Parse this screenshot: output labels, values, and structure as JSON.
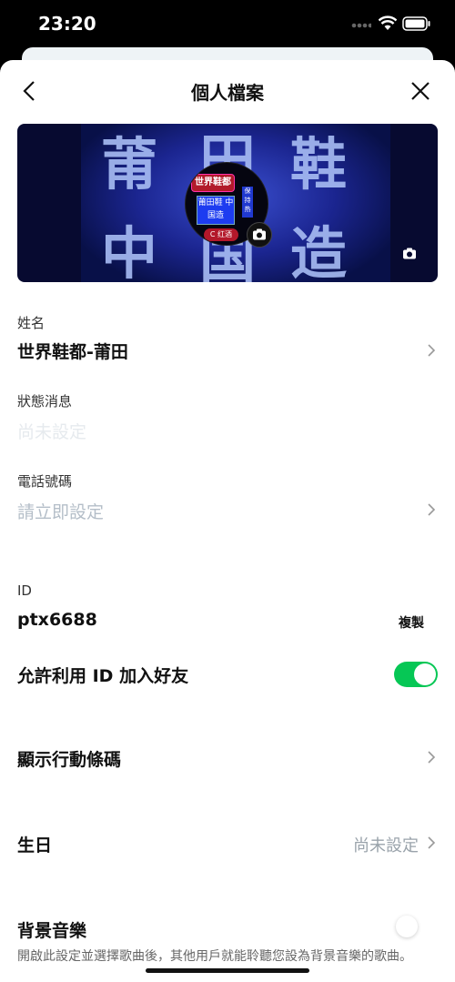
{
  "status": {
    "time": "23:20"
  },
  "header": {
    "title": "個人檔案"
  },
  "cover": {
    "characters": [
      "莆",
      "田",
      "鞋",
      "中",
      "国",
      "造"
    ],
    "avatar_signs": [
      "世界鞋都",
      "莆田鞋 中国造",
      "C 红酒",
      "保持 热"
    ]
  },
  "profile": {
    "name_label": "姓名",
    "name_value": "世界鞋都-莆田",
    "status_label": "狀態消息",
    "status_placeholder": "尚未設定",
    "phone_label": "電話號碼",
    "phone_placeholder": "請立即設定",
    "id_label": "ID",
    "id_value": "ptx6688",
    "copy_label": "複製",
    "allow_id_label": "允許利用 ID 加入好友",
    "allow_id_on": true,
    "barcode_label": "顯示行動條碼",
    "birthday_label": "生日",
    "birthday_value": "尚未設定",
    "bgm_label": "背景音樂",
    "bgm_on": false,
    "bgm_desc": "開啟此設定並選擇歌曲後，其他用戶就能聆聽您設為背景音樂的歌曲。"
  },
  "colors": {
    "accent": "#06c755",
    "placeholder": "#b4bec8"
  },
  "icons": [
    "back-icon",
    "close-icon",
    "camera-icon",
    "chevron-right-icon",
    "wifi-icon",
    "battery-icon"
  ]
}
